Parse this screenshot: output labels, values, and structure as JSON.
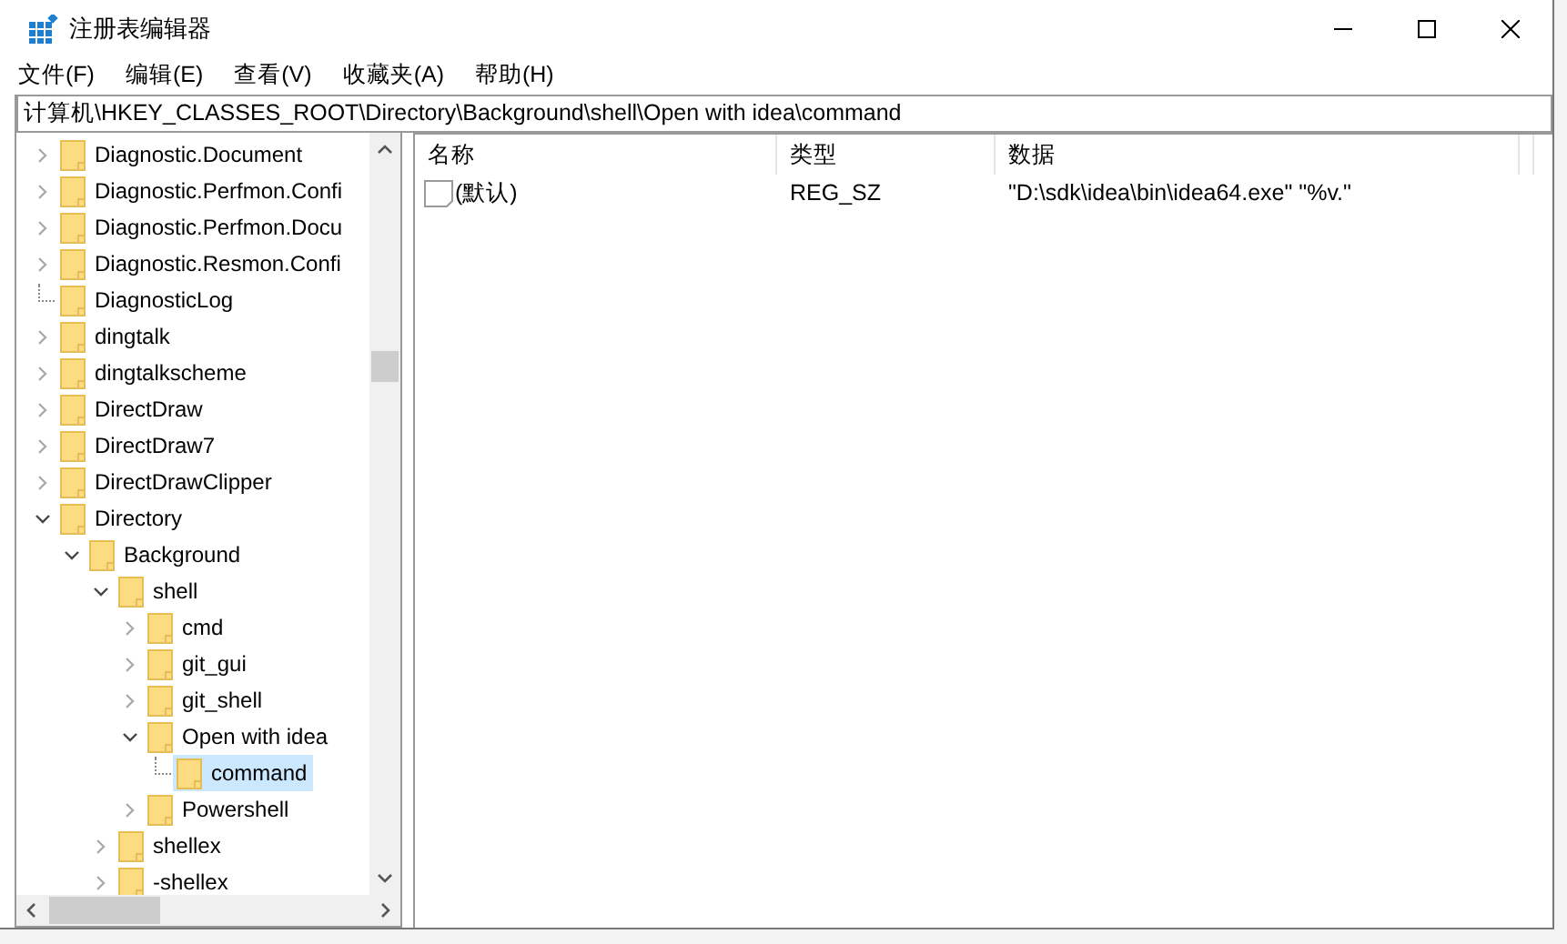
{
  "window": {
    "title": "注册表编辑器"
  },
  "menu": [
    "文件(F)",
    "编辑(E)",
    "查看(V)",
    "收藏夹(A)",
    "帮助(H)"
  ],
  "address": "计算机\\HKEY_CLASSES_ROOT\\Directory\\Background\\shell\\Open with idea\\command",
  "tree": [
    {
      "label": "Diagnostic.Document",
      "kind": "node",
      "expanded": false,
      "selected": false
    },
    {
      "label": "Diagnostic.Perfmon.Confi",
      "kind": "node",
      "expanded": false,
      "selected": false
    },
    {
      "label": "Diagnostic.Perfmon.Docu",
      "kind": "node",
      "expanded": false,
      "selected": false
    },
    {
      "label": "Diagnostic.Resmon.Confi",
      "kind": "node",
      "expanded": false,
      "selected": false
    },
    {
      "label": "DiagnosticLog",
      "kind": "leaf",
      "selected": false
    },
    {
      "label": "dingtalk",
      "kind": "node",
      "expanded": false,
      "selected": false
    },
    {
      "label": "dingtalkscheme",
      "kind": "node",
      "expanded": false,
      "selected": false
    },
    {
      "label": "DirectDraw",
      "kind": "node",
      "expanded": false,
      "selected": false
    },
    {
      "label": "DirectDraw7",
      "kind": "node",
      "expanded": false,
      "selected": false
    },
    {
      "label": "DirectDrawClipper",
      "kind": "node",
      "expanded": false,
      "selected": false
    },
    {
      "label": "Directory",
      "kind": "node",
      "expanded": true,
      "selected": false,
      "children": [
        {
          "label": "Background",
          "kind": "node",
          "expanded": true,
          "selected": false,
          "children": [
            {
              "label": "shell",
              "kind": "node",
              "expanded": true,
              "selected": false,
              "children": [
                {
                  "label": "cmd",
                  "kind": "node",
                  "expanded": false,
                  "selected": false
                },
                {
                  "label": "git_gui",
                  "kind": "node",
                  "expanded": false,
                  "selected": false
                },
                {
                  "label": "git_shell",
                  "kind": "node",
                  "expanded": false,
                  "selected": false
                },
                {
                  "label": "Open with idea",
                  "kind": "node",
                  "expanded": true,
                  "selected": false,
                  "children": [
                    {
                      "label": "command",
                      "kind": "leaf",
                      "selected": true
                    }
                  ]
                },
                {
                  "label": "Powershell",
                  "kind": "node",
                  "expanded": false,
                  "selected": false
                }
              ]
            },
            {
              "label": "shellex",
              "kind": "node",
              "expanded": false,
              "selected": false
            },
            {
              "label": "-shellex",
              "kind": "node",
              "expanded": false,
              "selected": false
            }
          ]
        }
      ]
    }
  ],
  "values": {
    "columns": [
      "名称",
      "类型",
      "数据"
    ],
    "rows": [
      {
        "name": "(默认)",
        "type": "REG_SZ",
        "data": "\"D:\\sdk\\idea\\bin\\idea64.exe\" \"%v.\""
      }
    ]
  }
}
